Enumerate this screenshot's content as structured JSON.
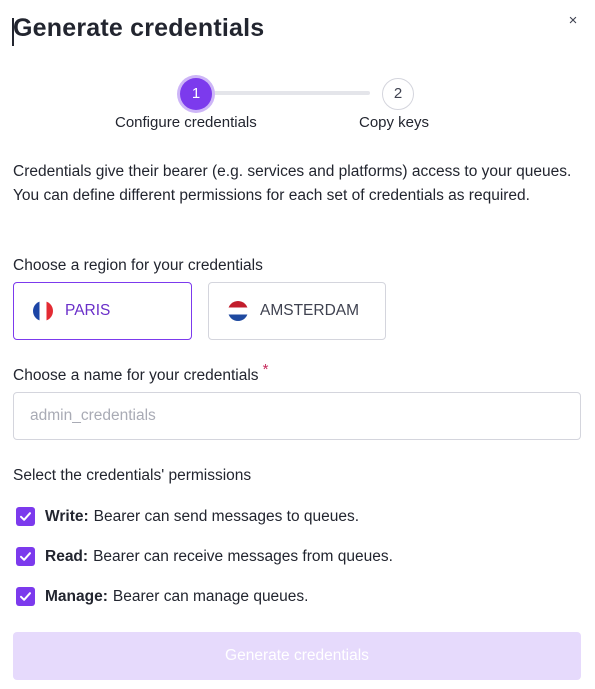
{
  "dialog": {
    "title": "Generate credentials",
    "close_glyph": "×",
    "close_icon": "close-icon"
  },
  "stepper": {
    "active_step": 1,
    "steps": [
      {
        "number": "1",
        "label": "Configure credentials"
      },
      {
        "number": "2",
        "label": "Copy keys"
      }
    ]
  },
  "description": "Credentials give their bearer (e.g. services and platforms) access to your queues. You can define different permissions for each set of credentials as required.",
  "region": {
    "label": "Choose a region for your credentials",
    "selected": "PARIS",
    "options": [
      {
        "name": "PARIS",
        "flag_icon": "france-flag-icon"
      },
      {
        "name": "AMSTERDAM",
        "flag_icon": "netherlands-flag-icon"
      }
    ]
  },
  "name_field": {
    "label": "Choose a name for your credentials",
    "required_marker": "*",
    "value": "",
    "placeholder": "admin_credentials"
  },
  "permissions": {
    "label": "Select the credentials' permissions",
    "items": [
      {
        "name": "Write:",
        "description": "Bearer can send messages to queues.",
        "checked": true
      },
      {
        "name": "Read:",
        "description": "Bearer can receive messages from queues.",
        "checked": true
      },
      {
        "name": "Manage:",
        "description": "Bearer can manage queues.",
        "checked": true
      }
    ]
  },
  "submit": {
    "label": "Generate credentials",
    "disabled": true
  },
  "colors": {
    "accent": "#7c3aed",
    "accent_light": "#e6dafc",
    "required": "#c62a5b",
    "border": "#d4d5dd"
  }
}
